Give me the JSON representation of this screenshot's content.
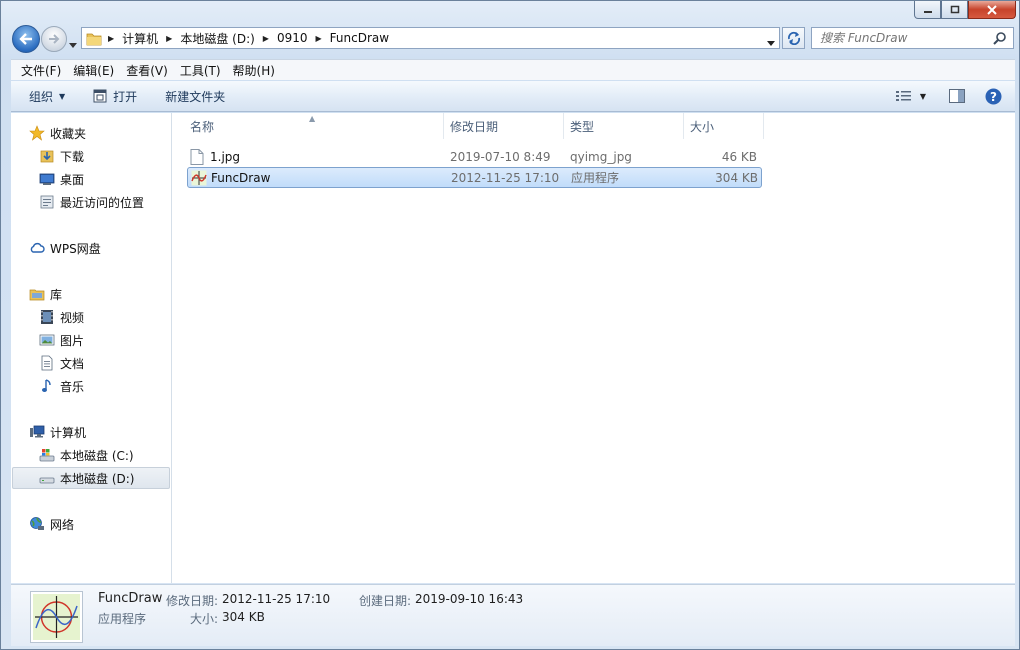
{
  "address": {
    "crumbs": [
      "计算机",
      "本地磁盘 (D:)",
      "0910",
      "FuncDraw"
    ]
  },
  "search": {
    "placeholder": "搜索 FuncDraw"
  },
  "menu": [
    "文件(F)",
    "编辑(E)",
    "查看(V)",
    "工具(T)",
    "帮助(H)"
  ],
  "toolbar": {
    "organize": "组织",
    "open": "打开",
    "new_folder": "新建文件夹"
  },
  "nav": {
    "favorites": "收藏夹",
    "downloads": "下载",
    "desktop": "桌面",
    "recent": "最近访问的位置",
    "wps": "WPS网盘",
    "libraries": "库",
    "videos": "视频",
    "pictures": "图片",
    "documents": "文档",
    "music": "音乐",
    "computer": "计算机",
    "drive_c": "本地磁盘 (C:)",
    "drive_d": "本地磁盘 (D:)",
    "network": "网络"
  },
  "columns": {
    "name": "名称",
    "date": "修改日期",
    "type": "类型",
    "size": "大小"
  },
  "files": [
    {
      "name": "1.jpg",
      "date": "2019-07-10 8:49",
      "type": "qyimg_jpg",
      "size": "46 KB"
    },
    {
      "name": "FuncDraw",
      "date": "2012-11-25 17:10",
      "type": "应用程序",
      "size": "304 KB"
    }
  ],
  "details": {
    "name": "FuncDraw",
    "kind": "应用程序",
    "modified_label": "修改日期:",
    "modified_value": "2012-11-25 17:10",
    "created_label": "创建日期:",
    "created_value": "2019-09-10 16:43",
    "size_label": "大小:",
    "size_value": "304 KB"
  },
  "colors": {
    "selection": "#c1dcfa",
    "selection_border": "#7da2ce",
    "toolbar_text": "#1e395b"
  }
}
